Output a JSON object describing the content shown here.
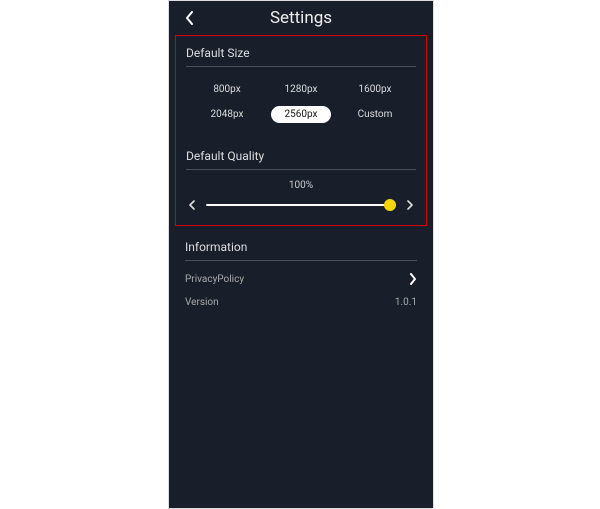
{
  "header": {
    "title": "Settings"
  },
  "defaultSize": {
    "heading": "Default Size",
    "options": [
      "800px",
      "1280px",
      "1600px",
      "2048px",
      "2560px",
      "Custom"
    ],
    "selectedIndex": 4
  },
  "quality": {
    "heading": "Default Quality",
    "valueLabel": "100%",
    "percent": 100
  },
  "information": {
    "heading": "Information",
    "privacyLabel": "PrivacyPolicy",
    "versionLabel": "Version",
    "versionValue": "1.0.1"
  }
}
